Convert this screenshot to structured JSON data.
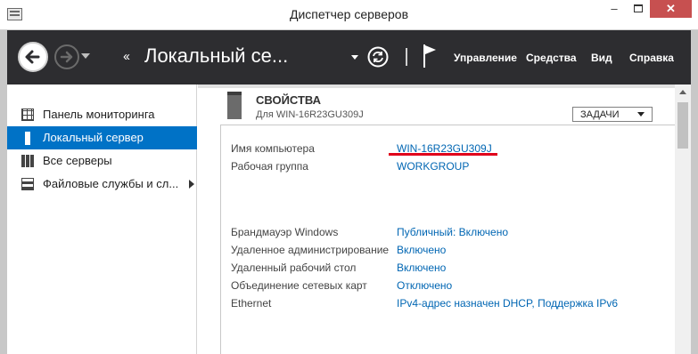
{
  "window": {
    "title": "Диспетчер серверов",
    "minimize": "–",
    "close": "✕"
  },
  "toolbar": {
    "breadcrumb_arrows": "‹‹",
    "breadcrumb_title": "Локальный се...",
    "menu": [
      "Управление",
      "Средства",
      "Вид",
      "Справка"
    ]
  },
  "sidebar": {
    "items": [
      {
        "label": "Панель мониторинга",
        "icon": "dashboard-icon"
      },
      {
        "label": "Локальный сервер",
        "icon": "server-icon",
        "active": true
      },
      {
        "label": "Все серверы",
        "icon": "servers-icon"
      },
      {
        "label": "Файловые службы и сл...",
        "icon": "file-services-icon",
        "has_submenu": true
      }
    ]
  },
  "properties": {
    "title": "СВОЙСТВА",
    "subtitle": "Для WIN-16R23GU309J",
    "tasks_label": "ЗАДАЧИ",
    "rows": [
      {
        "key": "Имя компьютера",
        "value": "WIN-16R23GU309J"
      },
      {
        "key": "Рабочая группа",
        "value": "WORKGROUP"
      },
      {
        "key": "Брандмауэр Windows",
        "value": "Публичный: Включено"
      },
      {
        "key": "Удаленное администрирование",
        "value": "Включено"
      },
      {
        "key": "Удаленный рабочий стол",
        "value": "Включено"
      },
      {
        "key": "Объединение сетевых карт",
        "value": "Отключено"
      },
      {
        "key": "Ethernet",
        "value": "IPv4-адрес назначен DHCP, Поддержка IPv6"
      }
    ]
  },
  "colors": {
    "accent": "#0072c6",
    "link": "#0066b3",
    "toolbar_bg": "#2d2d30",
    "highlight_underline": "#e0001b",
    "close_button": "#c75050"
  }
}
